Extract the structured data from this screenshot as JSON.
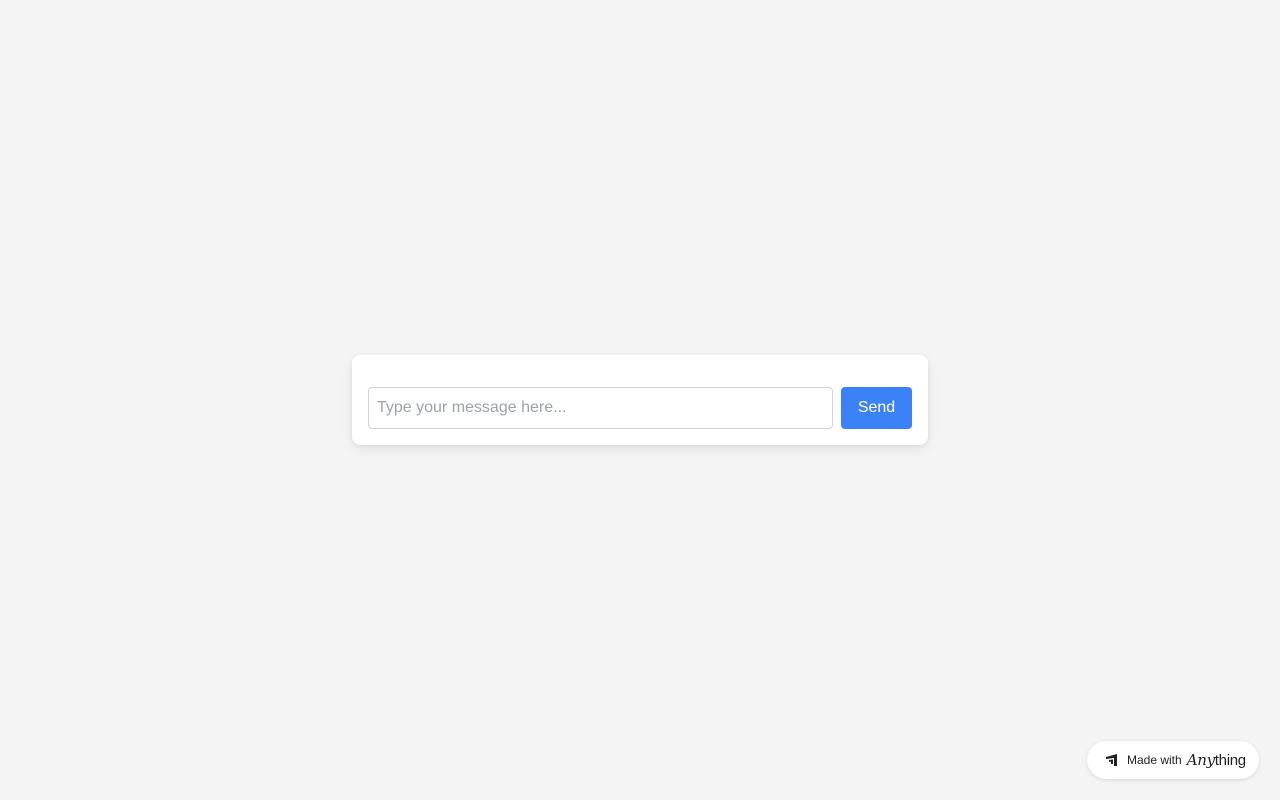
{
  "chat": {
    "input_placeholder": "Type your message here...",
    "input_value": "",
    "send_label": "Send"
  },
  "badge": {
    "prefix": "Made with",
    "brand_part1": "Any",
    "brand_part2": "thing",
    "icon": "anything-logo-icon"
  },
  "colors": {
    "background": "#f4f4f4",
    "accent": "#3b82f6",
    "card": "#ffffff"
  }
}
